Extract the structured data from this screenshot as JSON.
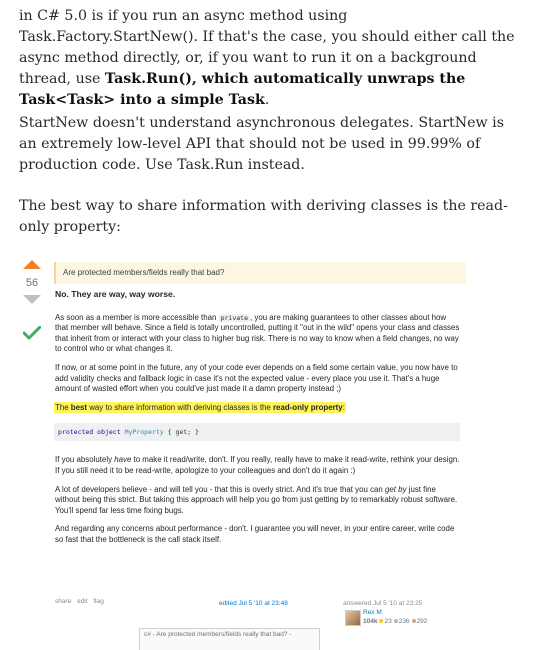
{
  "article": {
    "p1": {
      "before": "in C# 5.0 is if you run an async method using Task.Factory.StartNew(). If that's the case, you should either call the async method directly, or, if you want to run it on a background thread, use ",
      "bold": "Task.Run(), which automatically unwraps the Task<Task> into a simple Task",
      "after": "."
    },
    "p2": "StartNew doesn't understand asynchronous delegates. StartNew is an extremely low-level API that should not be used in 99.99% of production code. Use Task.Run instead.",
    "p3": "The best way to share information with deriving classes is the read-only property:"
  },
  "screenshot": {
    "vote_count": "56",
    "comment": "Are protected members/fields really that bad?",
    "lead": "No. They are way, way worse.",
    "para1_a": "As soon as a member is more accessible than ",
    "para1_code": "private",
    "para1_b": ", you are making guarantees to other classes about how that member will behave. Since a field is totally uncontrolled, putting it \"out in the wild\" opens your class and classes that inherit from or interact with your class to higher bug risk. There is no way to know when a field changes, no way to control who or what changes it.",
    "para2": "If now, or at some point in the future, any of your code ever depends on a field some certain value, you now have to add validity checks and fallback logic in case it's not the expected value - every place you use it. That's a huge amount of wasted effort when you could've just made it a damn property instead ;)",
    "hl_a": "The ",
    "hl_b1": "best",
    "hl_c": " way to share information with deriving classes is the ",
    "hl_b2": "read-only property",
    "hl_d": ":",
    "code_kw1": "protected",
    "code_kw2": "object",
    "code_ty": "MyProperty",
    "code_rest": "{ get; }",
    "para3_a": "If you absolutely ",
    "para3_em": "have",
    "para3_b": " to make it read/write, don't. If you really, really have to make it read-write, rethink your design. If you still need it to be read-write, apologize to your colleagues and don't do it again :)",
    "para4_a": "A lot of developers believe - and will tell you - that this is overly strict. And it's true that you can ",
    "para4_em": "get by",
    "para4_b": " just fine without being this strict. But taking this approach will help you go from just getting by to remarkably robust software. You'll spend far less time fixing bugs.",
    "para5": "And regarding any concerns about performance - don't. I guarantee you will never, in your entire career, write code so fast that the bottleneck is the call stack itself.",
    "footer": {
      "share": "share",
      "edit": "edit",
      "flag": "flag",
      "edited": "edited Jul 5 '10 at 23:48",
      "answered": "answered Jul 5 '10 at 23:25",
      "user": "Rex M",
      "rep": "104k",
      "gold": "23",
      "silver": "236",
      "bronze": "292"
    },
    "tab_text": "c# - Are protected members/fields really that bad? - "
  }
}
